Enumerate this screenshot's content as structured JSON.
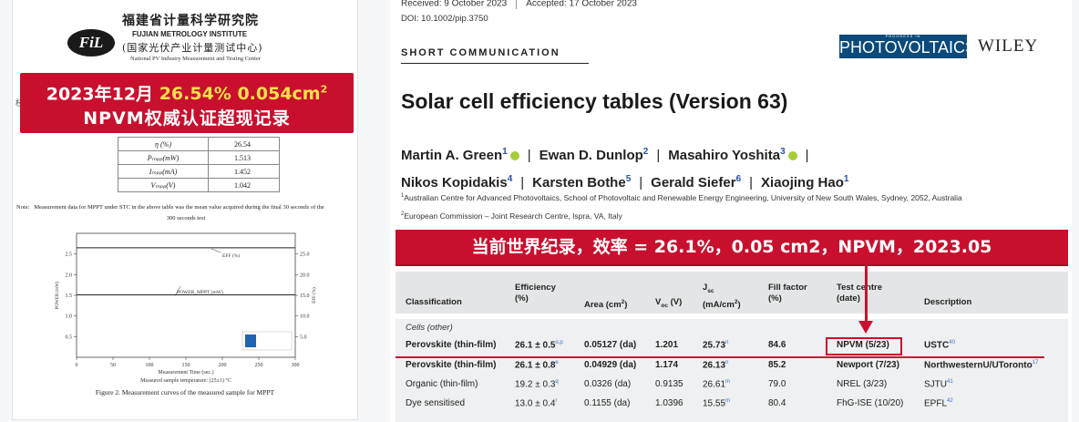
{
  "left_doc": {
    "org_cn": "福建省计量科学研究院",
    "org_en": "FUJIAN METROLOGY INSTITUTE",
    "org_cn2": "(国家光伏产业计量测试中心)",
    "org_en2": "National PV Industry Measurement and Testing Center",
    "logo_text": "FiL",
    "banner_line1_prefix": "2023年12月",
    "banner_line1_highlight": "26.54% 0.054cm",
    "banner_line1_sup": "2",
    "banner_line2": "NPVM权威认证超现记录",
    "table": [
      {
        "param": "η (%)",
        "value": "26.54"
      },
      {
        "param": "Pₘₚₚ(mW)",
        "value": "1.513"
      },
      {
        "param": "Iₘₚₚ(mA)",
        "value": "1.452"
      },
      {
        "param": "Vₘₚₚ(V)",
        "value": "1.042"
      }
    ],
    "note_label": "Note:",
    "note_text": "Measurement data for MPPT under STC in the above table was the mean value acquired during the final 30 seconds of the",
    "note_text2": "300 seconds test",
    "chart_labels": {
      "eff_label": "EFF (%)",
      "power_label": "POWER_MPPT (mW)",
      "x_label": "Measurement Time (sec.)",
      "x_sub": "Measured sample temperature: (25±1) °C",
      "y_left": "POWER (mW)",
      "y_right": "EFF (%)"
    },
    "figure_caption": "Figure 2. Measurement curves of the measured sample for MPPT"
  },
  "chart_data": {
    "type": "line",
    "title": "",
    "xlabel": "Measurement Time (sec.)",
    "ylabel": "POWER (mW)",
    "y2label": "EFF (%)",
    "xlim": [
      0,
      300
    ],
    "ylim": [
      0,
      3.0
    ],
    "y2lim": [
      0,
      30
    ],
    "x_ticks": [
      0,
      50,
      100,
      150,
      200,
      250,
      300
    ],
    "y_ticks": [
      0.5,
      1.0,
      1.5,
      2.0,
      2.5
    ],
    "y2_ticks": [
      5,
      10,
      15,
      20,
      25
    ],
    "series": [
      {
        "name": "EFF (%)",
        "axis": "right",
        "x": [
          0,
          300
        ],
        "values": [
          26.5,
          26.5
        ]
      },
      {
        "name": "POWER_MPPT (mW)",
        "axis": "left",
        "x": [
          0,
          300
        ],
        "values": [
          1.51,
          1.51
        ]
      }
    ]
  },
  "right_doc": {
    "received": "Received: 9 October 2023",
    "accepted": "Accepted: 17 October 2023",
    "doi": "DOI: 10.1002/pip.3750",
    "section": "SHORT COMMUNICATION",
    "journal_logo": "PHOTOVOLTAICS",
    "journal_prefix": "PROGRESS IN",
    "publisher": "WILEY",
    "title": "Solar cell efficiency tables (Version 63)",
    "authors_line1": [
      {
        "name": "Martin A. Green",
        "sup": "1",
        "orcid": true
      },
      {
        "name": "Ewan D. Dunlop",
        "sup": "2",
        "orcid": false
      },
      {
        "name": "Masahiro Yoshita",
        "sup": "3",
        "orcid": true
      }
    ],
    "authors_line2": [
      {
        "name": "Nikos Kopidakis",
        "sup": "4"
      },
      {
        "name": "Karsten Bothe",
        "sup": "5"
      },
      {
        "name": "Gerald Siefer",
        "sup": "6"
      },
      {
        "name": "Xiaojing Hao",
        "sup": "1"
      }
    ],
    "affiliation1": "Australian Centre for Advanced Photovoltaics, School of Photovoltaic and Renewable Energy Engineering, University of New South Wales, Sydney, 2052, Australia",
    "affiliation2": "European Commission – Joint Research Centre, Ispra, VA, Italy",
    "banner": "当前世界纪录，效率 = 26.1%，0.05 cm2，NPVM，2023.05",
    "headers": {
      "classification": "Classification",
      "efficiency": "Efficiency",
      "efficiency_unit": "(%)",
      "area": "Area (cm",
      "voc": "V",
      "voc_sub": "oc",
      "voc_unit": " (V)",
      "jsc": "J",
      "jsc_sub": "sc",
      "jsc_unit": "(mA/cm",
      "ff": "Fill factor",
      "ff_unit": "(%)",
      "test_centre": "Test centre",
      "test_centre_unit": "(date)",
      "description": "Description"
    },
    "group_label": "Cells (other)",
    "rows": [
      {
        "classification": "Perovskite (thin-film)",
        "efficiency": "26.1 ± 0.5",
        "eff_sup": "o,p",
        "area": "0.05127 (da)",
        "voc": "1.201",
        "jsc": "25.73",
        "jsc_sup": "n",
        "ff": "84.6",
        "centre": "NPVM (5/23)",
        "description": "USTC",
        "desc_sup": "40"
      },
      {
        "classification": "Perovskite (thin-film)",
        "efficiency": "26.1 ± 0.8",
        "eff_sup": "e",
        "area": "0.04929 (da)",
        "voc": "1.174",
        "jsc": "26.13",
        "jsc_sup": "n",
        "ff": "85.2",
        "centre": "Newport (7/23)",
        "description": "NorthwesternU/UToronto",
        "desc_sup": "17"
      },
      {
        "classification": "Organic (thin-film)",
        "efficiency": "19.2 ± 0.3",
        "eff_sup": "q",
        "area": "0.0326 (da)",
        "voc": "0.9135",
        "jsc": "26.61",
        "jsc_sup": "m",
        "ff": "79.0",
        "centre": "NREL (3/23)",
        "description": "SJTU",
        "desc_sup": "41"
      },
      {
        "classification": "Dye sensitised",
        "efficiency": "13.0 ± 0.4",
        "eff_sup": "r",
        "area": "0.1155 (da)",
        "voc": "1.0396",
        "jsc": "15.55",
        "jsc_sup": "m",
        "ff": "80.4",
        "centre": "FhG-ISE (10/20)",
        "description": "EPFL",
        "desc_sup": "42"
      }
    ]
  }
}
